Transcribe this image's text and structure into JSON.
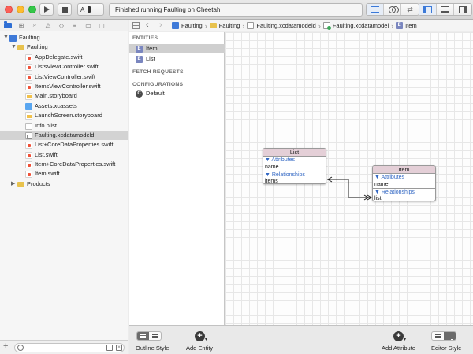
{
  "toolbar": {
    "activity_text": "Finished running Faulting on Cheetah"
  },
  "navigator": {
    "items": [
      {
        "label": "Faulting",
        "kind": "proj",
        "level": 0,
        "disclosure": "open",
        "selected": false
      },
      {
        "label": "Faulting",
        "kind": "folder",
        "level": 1,
        "disclosure": "open",
        "selected": false
      },
      {
        "label": "AppDelegate.swift",
        "kind": "swift",
        "level": 2,
        "disclosure": "",
        "selected": false
      },
      {
        "label": "ListsViewController.swift",
        "kind": "swift",
        "level": 2,
        "disclosure": "",
        "selected": false
      },
      {
        "label": "ListViewController.swift",
        "kind": "swift",
        "level": 2,
        "disclosure": "",
        "selected": false
      },
      {
        "label": "ItemsViewController.swift",
        "kind": "swift",
        "level": 2,
        "disclosure": "",
        "selected": false
      },
      {
        "label": "Main.storyboard",
        "kind": "sb",
        "level": 2,
        "disclosure": "",
        "selected": false
      },
      {
        "label": "Assets.xcassets",
        "kind": "assets",
        "level": 2,
        "disclosure": "",
        "selected": false
      },
      {
        "label": "LaunchScreen.storyboard",
        "kind": "sb",
        "level": 2,
        "disclosure": "",
        "selected": false
      },
      {
        "label": "Info.plist",
        "kind": "plist",
        "level": 2,
        "disclosure": "",
        "selected": false
      },
      {
        "label": "Faulting.xcdatamodeld",
        "kind": "xcdm",
        "level": 2,
        "disclosure": "",
        "selected": true
      },
      {
        "label": "List+CoreDataProperties.swift",
        "kind": "swift",
        "level": 2,
        "disclosure": "",
        "selected": false
      },
      {
        "label": "List.swift",
        "kind": "swift",
        "level": 2,
        "disclosure": "",
        "selected": false
      },
      {
        "label": "Item+CoreDataProperties.swift",
        "kind": "swift",
        "level": 2,
        "disclosure": "",
        "selected": false
      },
      {
        "label": "Item.swift",
        "kind": "swift",
        "level": 2,
        "disclosure": "",
        "selected": false
      },
      {
        "label": "Products",
        "kind": "folder",
        "level": 1,
        "disclosure": "closed",
        "selected": false
      }
    ]
  },
  "jumpbar": {
    "crumbs": [
      {
        "label": "Faulting",
        "icon": "proj"
      },
      {
        "label": "Faulting",
        "icon": "folder"
      },
      {
        "label": "Faulting.xcdatamodeld",
        "icon": "xcdm"
      },
      {
        "label": "Faulting.xcdatamodel",
        "icon": "model"
      },
      {
        "label": "Item",
        "icon": "entity"
      }
    ]
  },
  "outline": {
    "entities_header": "ENTITIES",
    "entities": [
      {
        "label": "Item",
        "badge": "E",
        "selected": true
      },
      {
        "label": "List",
        "badge": "E",
        "selected": false
      }
    ],
    "fetch_header": "FETCH REQUESTS",
    "config_header": "CONFIGURATIONS",
    "configurations": [
      {
        "label": "Default",
        "badge": "C"
      }
    ]
  },
  "graph": {
    "list_entity": {
      "title": "List",
      "attributes_label": "▼ Attributes",
      "attributes": [
        "name"
      ],
      "relationships_label": "▼ Relationships",
      "relationships": [
        "items"
      ]
    },
    "item_entity": {
      "title": "Item",
      "attributes_label": "▼ Attributes",
      "attributes": [
        "name"
      ],
      "relationships_label": "▼ Relationships",
      "relationships": [
        "list"
      ]
    }
  },
  "bottombar": {
    "outline_style_label": "Outline Style",
    "add_entity_label": "Add Entity",
    "add_attribute_label": "Add Attribute",
    "editor_style_label": "Editor Style"
  },
  "colors": {
    "accent": "#2f6fd4",
    "entity_header": "#e4cfd7",
    "selection": "#d3d3d3"
  }
}
